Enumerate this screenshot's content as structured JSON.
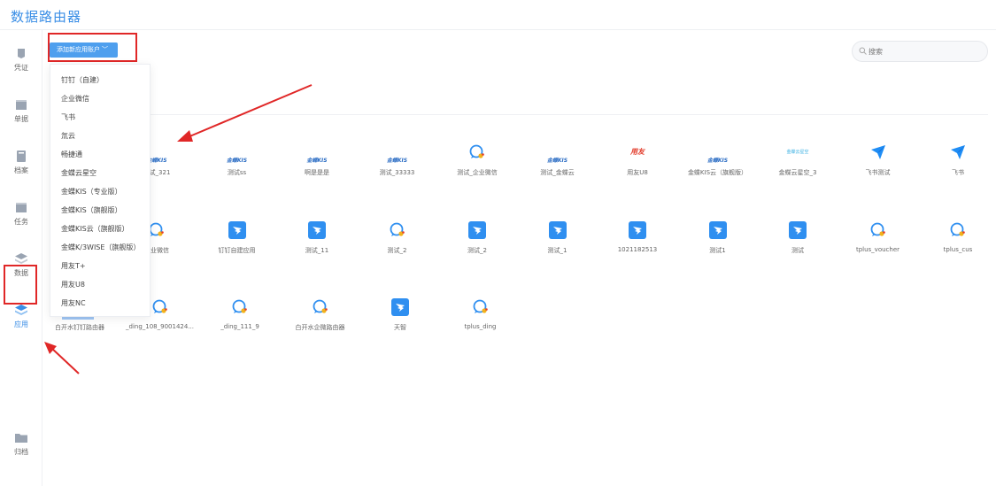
{
  "app": {
    "title": "数据路由器"
  },
  "sidebar": {
    "items": [
      {
        "label": "凭证",
        "icon": "voucher-icon"
      },
      {
        "label": "单据",
        "icon": "document-icon"
      },
      {
        "label": "档案",
        "icon": "archive-icon"
      },
      {
        "label": "任务",
        "icon": "task-icon"
      },
      {
        "label": "数据",
        "icon": "data-icon"
      },
      {
        "label": "应用",
        "icon": "app-layers-icon",
        "active": true
      },
      {
        "label": "归档",
        "icon": "folder-icon"
      }
    ]
  },
  "toolbar": {
    "add_label": "添加新应用账户"
  },
  "dropdown": {
    "items": [
      "钉钉（自建）",
      "企业微信",
      "飞书",
      "氚云",
      "畅捷通",
      "金蝶云星空",
      "金蝶KIS（专业版）",
      "金蝶KIS（旗舰版）",
      "金蝶KIS云（旗舰版）",
      "金蝶K/3WISE（旗舰版）",
      "用友T+",
      "用友U8",
      "用友NC"
    ]
  },
  "search": {
    "placeholder": "搜索"
  },
  "apps": {
    "row1": [
      {
        "label": "测试_321",
        "icon": "kingdee-kis-icon",
        "logo_text": "金蝶KIS"
      },
      {
        "label": "测试ss",
        "icon": "kingdee-kis-icon",
        "logo_text": "金蝶KIS"
      },
      {
        "label": "啊是是是",
        "icon": "kingdee-kis-icon",
        "logo_text": "金蝶KIS"
      },
      {
        "label": "测试_33333",
        "icon": "kingdee-kis-icon",
        "logo_text": "金蝶KIS"
      },
      {
        "label": "测试_企业微信",
        "icon": "wechat-work-icon"
      },
      {
        "label": "测试_金蝶云",
        "icon": "kingdee-kis-icon",
        "logo_text": "金蝶KIS"
      },
      {
        "label": "用友U8",
        "icon": "yonyou-logo-icon",
        "logo_text": "用友"
      },
      {
        "label": "金蝶KIS云（旗舰版）",
        "icon": "kingdee-kis-icon",
        "logo_text": "金蝶KIS"
      },
      {
        "label": "金蝶云星空_3",
        "icon": "kingdee-cloud-icon",
        "logo_text": "金蝶云星空"
      },
      {
        "label": "飞书测试",
        "icon": "feishu-icon"
      },
      {
        "label": "飞书",
        "icon": "feishu-icon"
      }
    ],
    "row2": [
      {
        "label": "企业微信",
        "icon": "wechat-work-icon"
      },
      {
        "label": "钉钉自建应用",
        "icon": "dingtalk-icon"
      },
      {
        "label": "测试_11",
        "icon": "dingtalk-icon"
      },
      {
        "label": "测试_2",
        "icon": "wechat-work-icon"
      },
      {
        "label": "测试_2",
        "icon": "dingtalk-icon"
      },
      {
        "label": "测试_1",
        "icon": "dingtalk-icon"
      },
      {
        "label": "1021182513",
        "icon": "dingtalk-icon"
      },
      {
        "label": "测试1",
        "icon": "dingtalk-icon"
      },
      {
        "label": "测试",
        "icon": "dingtalk-icon"
      },
      {
        "label": "tplus_voucher",
        "icon": "wechat-work-icon"
      },
      {
        "label": "tplus_cus",
        "icon": "wechat-work-icon"
      }
    ],
    "row3": [
      {
        "label": "白开水钉钉路由器",
        "icon": "dingtalk-icon"
      },
      {
        "label": "_ding_108_9001424...",
        "icon": "wechat-work-icon"
      },
      {
        "label": "_ding_111_9",
        "icon": "wechat-work-icon"
      },
      {
        "label": "白开水企微路由器",
        "icon": "wechat-work-icon"
      },
      {
        "label": "天智",
        "icon": "dingtalk-icon"
      },
      {
        "label": "tplus_ding",
        "icon": "wechat-work-icon"
      }
    ]
  },
  "colors": {
    "accent": "#3a8ee6",
    "button": "#4e9fee",
    "annotation": "#e02727",
    "dingtalk": "#2f8ff0",
    "feishu": "#1f8df5"
  }
}
